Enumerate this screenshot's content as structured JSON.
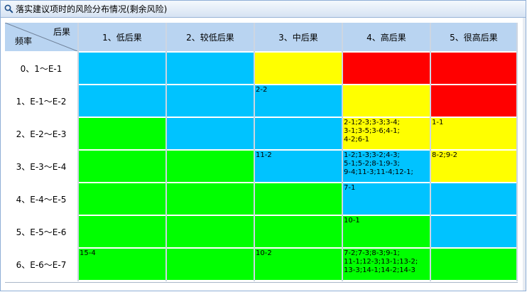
{
  "window": {
    "title": "落实建议项时的风险分布情况(剩余风险)",
    "search_icon": "search-icon"
  },
  "matrix": {
    "corner_top": "后果",
    "corner_bottom": "频率",
    "columns": [
      "1、低后果",
      "2、较低后果",
      "3、中后果",
      "4、高后果",
      "5、很高后果"
    ],
    "rows": [
      {
        "label": "0、1～E-1",
        "cells": [
          {
            "color": "#00c3ff",
            "text": ""
          },
          {
            "color": "#00c3ff",
            "text": ""
          },
          {
            "color": "#ffff00",
            "text": ""
          },
          {
            "color": "#ff0000",
            "text": ""
          },
          {
            "color": "#ff0000",
            "text": ""
          }
        ]
      },
      {
        "label": "1、E-1～E-2",
        "cells": [
          {
            "color": "#00c3ff",
            "text": ""
          },
          {
            "color": "#00c3ff",
            "text": ""
          },
          {
            "color": "#00c3ff",
            "text": "2-2"
          },
          {
            "color": "#ffff00",
            "text": ""
          },
          {
            "color": "#ff0000",
            "text": ""
          }
        ]
      },
      {
        "label": "2、E-2～E-3",
        "cells": [
          {
            "color": "#00ff00",
            "text": ""
          },
          {
            "color": "#00c3ff",
            "text": ""
          },
          {
            "color": "#00c3ff",
            "text": ""
          },
          {
            "color": "#ffff00",
            "text": "2-1;2-3;3-3;3-4;\n3-1;3-5;3-6;4-1;\n4-2;6-1"
          },
          {
            "color": "#ffff00",
            "text": "1-1"
          }
        ]
      },
      {
        "label": "3、E-3～E-4",
        "cells": [
          {
            "color": "#00ff00",
            "text": ""
          },
          {
            "color": "#00ff00",
            "text": ""
          },
          {
            "color": "#00c3ff",
            "text": "11-2"
          },
          {
            "color": "#00c3ff",
            "text": "1-2;1-3;3-2;4-3;\n5-1;5-2;8-1;9-3;\n9-4;11-3;11-4;12-1;"
          },
          {
            "color": "#ffff00",
            "text": "8-2;9-2"
          }
        ]
      },
      {
        "label": "4、E-4～E-5",
        "cells": [
          {
            "color": "#00ff00",
            "text": ""
          },
          {
            "color": "#00ff00",
            "text": ""
          },
          {
            "color": "#00ff00",
            "text": ""
          },
          {
            "color": "#00c3ff",
            "text": "7-1"
          },
          {
            "color": "#00c3ff",
            "text": ""
          }
        ]
      },
      {
        "label": "5、E-5～E-6",
        "cells": [
          {
            "color": "#00ff00",
            "text": ""
          },
          {
            "color": "#00ff00",
            "text": ""
          },
          {
            "color": "#00ff00",
            "text": ""
          },
          {
            "color": "#00ff00",
            "text": "10-1"
          },
          {
            "color": "#00c3ff",
            "text": ""
          }
        ]
      },
      {
        "label": "6、E-6～E-7",
        "cells": [
          {
            "color": "#00ff00",
            "text": "15-4"
          },
          {
            "color": "#00ff00",
            "text": ""
          },
          {
            "color": "#00ff00",
            "text": "10-2"
          },
          {
            "color": "#00ff00",
            "text": "7-2;7-3;8-3;9-1;\n11-1;12-3;13-1;13-2;\n13-3;14-1;14-2;14-3"
          },
          {
            "color": "#00ff00",
            "text": ""
          }
        ]
      }
    ]
  }
}
